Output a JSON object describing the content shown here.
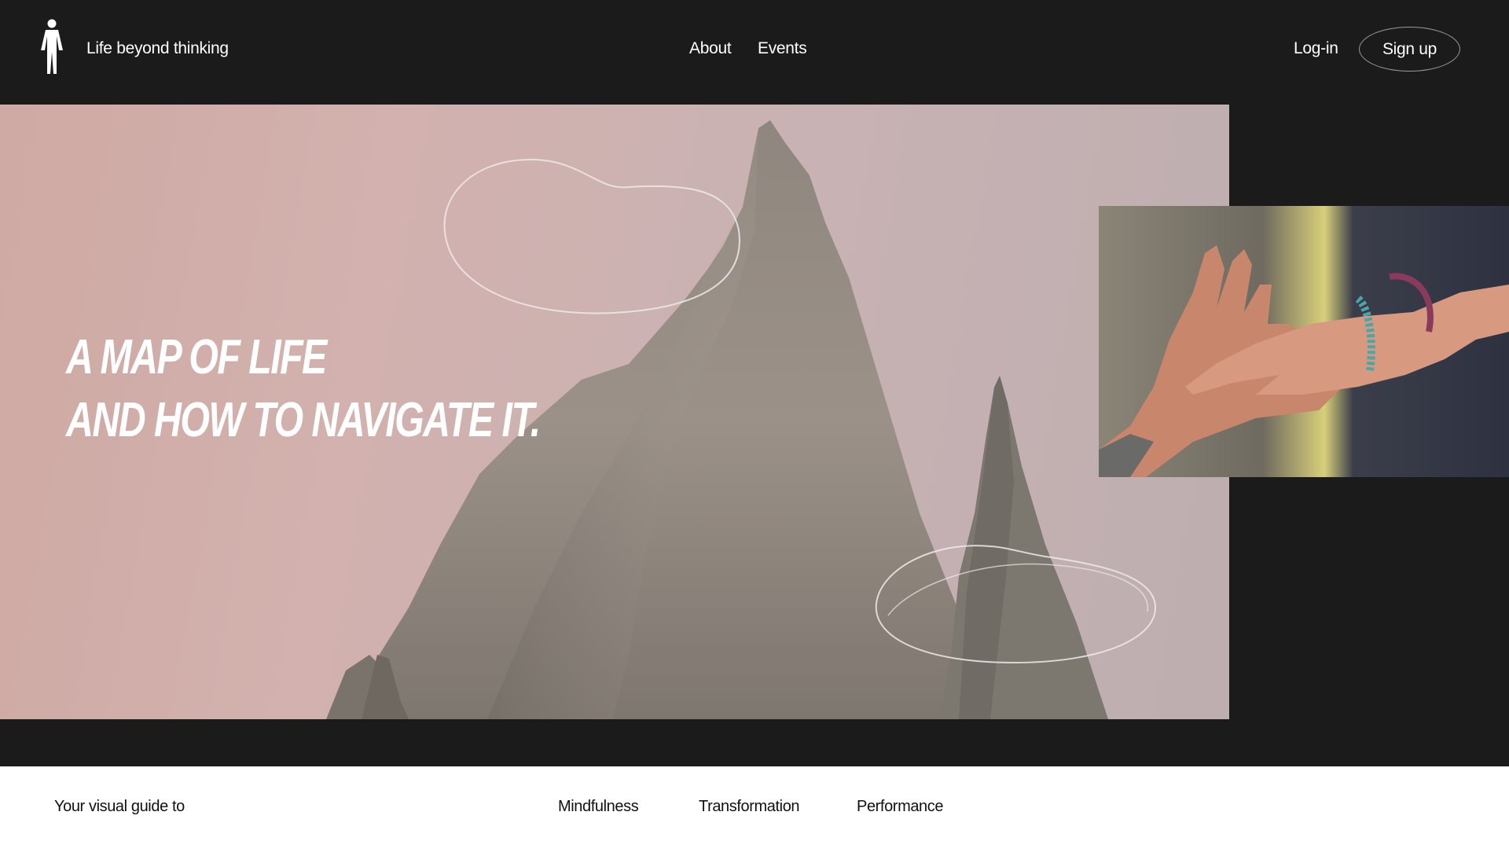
{
  "header": {
    "brand": "Life beyond thinking",
    "logo_icon": "person-figure-icon",
    "nav": [
      "About",
      "Events"
    ],
    "login": "Log-in",
    "signup": "Sign up"
  },
  "hero": {
    "headline_line1": "A MAP OF LIFE",
    "headline_line2": "AND HOW TO NAVIGATE IT."
  },
  "footer_band": {
    "lead": "Your visual guide to",
    "topics": [
      "Mindfulness",
      "Transformation",
      "Performance"
    ]
  },
  "colors": {
    "background": "#1b1b1b",
    "text": "#ffffff",
    "hero_pink": "#d2b1ae",
    "band": "#ffffff"
  }
}
